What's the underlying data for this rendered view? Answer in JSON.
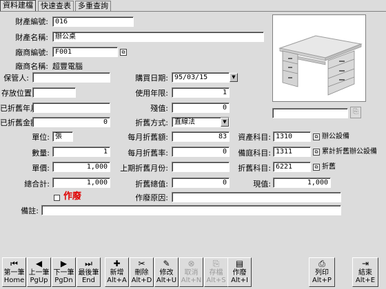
{
  "tabs": [
    "資料建檔",
    "快速查表",
    "多重查詢"
  ],
  "labels": {
    "asset_no": "財產編號:",
    "asset_name": "財產名稱:",
    "vendor_no": "廠商編號:",
    "vendor_name": "廠商名稱:",
    "custodian": "保管人:",
    "location": "存放位置:",
    "depr_months": "已折舊年月:",
    "depr_amount": "已折舊金額:",
    "unit": "單位:",
    "qty": "數量:",
    "price": "單價:",
    "total": "總合計:",
    "purchase_date": "購買日期:",
    "life": "使用年限:",
    "residual": "殘值:",
    "method": "折舊方式:",
    "monthly_amount": "每月折舊額:",
    "monthly_rate": "每月折舊率:",
    "last_month": "上期折舊月份:",
    "depr_total": "折舊總值:",
    "asset_subject": "資產科目:",
    "prep_subject": "備庭科目:",
    "depr_subject": "折舊科目:",
    "present_value": "現值:",
    "scrap": "作廢",
    "scrap_reason": "作廢原因:",
    "note": "備註:"
  },
  "values": {
    "asset_no": "016",
    "asset_name": "辦公桌",
    "vendor_no": "F001",
    "vendor_name": "超豐電腦",
    "custodian": "",
    "location": "",
    "depr_months": "",
    "depr_amount": "0",
    "unit": "張",
    "qty": "1",
    "price": "1,000",
    "total": "1,000",
    "purchase_date": "95/03/15",
    "life": "1",
    "residual": "0",
    "method": "直線法",
    "monthly_amount": "83",
    "monthly_rate": "0",
    "last_month": "",
    "depr_total": "0",
    "asset_subject": "1310",
    "asset_subject_name": "辦公設備",
    "prep_subject": "1311",
    "prep_subject_name": "累計折舊辦公設備",
    "depr_subject": "6221",
    "depr_subject_name": "折舊",
    "present_value": "1,000",
    "scrap_reason": "",
    "note": "",
    "image_path": ""
  },
  "toolbar": [
    {
      "label": "第一筆",
      "key": "Home",
      "icon": "first-record-icon",
      "glyph": "⏮"
    },
    {
      "label": "上一筆",
      "key": "PgUp",
      "icon": "prev-record-icon",
      "glyph": "◀"
    },
    {
      "label": "下一筆",
      "key": "PgDn",
      "icon": "next-record-icon",
      "glyph": "▶"
    },
    {
      "label": "最後筆",
      "key": "End",
      "icon": "last-record-icon",
      "glyph": "⏭"
    },
    {
      "label": "新增",
      "key": "Alt+A",
      "icon": "add-icon",
      "glyph": "✚"
    },
    {
      "label": "刪除",
      "key": "Alt+D",
      "icon": "delete-icon",
      "glyph": "✂"
    },
    {
      "label": "修改",
      "key": "Alt+U",
      "icon": "edit-icon",
      "glyph": "✎"
    },
    {
      "label": "取消",
      "key": "Alt+N",
      "icon": "cancel-icon",
      "glyph": "⊗"
    },
    {
      "label": "存檔",
      "key": "Alt+S",
      "icon": "save-icon",
      "glyph": "⎘"
    },
    {
      "label": "作廢",
      "key": "Alt+I",
      "icon": "void-icon",
      "glyph": "▤"
    },
    {
      "label": "列印",
      "key": "Alt+P",
      "icon": "print-icon",
      "glyph": "⎙"
    },
    {
      "label": "結束",
      "key": "Alt+E",
      "icon": "exit-icon",
      "glyph": "⇥"
    }
  ],
  "colors": {
    "background": "#dcdcdc",
    "scrap_label": "#e00000"
  }
}
